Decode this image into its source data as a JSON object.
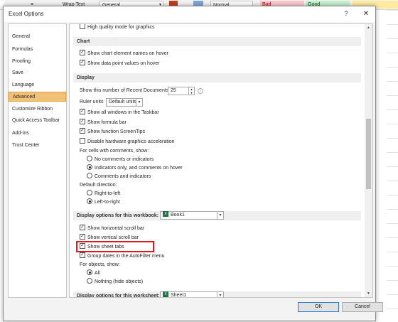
{
  "ribbon": {
    "font_fragment": "",
    "wrap_text": "Wrap Text",
    "number_format": "General",
    "styles": {
      "normal": "Normal",
      "bad": "Bad",
      "good": "Good"
    }
  },
  "dialog": {
    "title": "Excel Options",
    "help_glyph": "?",
    "close_glyph": "✕"
  },
  "nav": {
    "items": [
      {
        "label": "General",
        "selected": false
      },
      {
        "label": "Formulas",
        "selected": false
      },
      {
        "label": "Proofing",
        "selected": false
      },
      {
        "label": "Save",
        "selected": false
      },
      {
        "label": "Language",
        "selected": false
      },
      {
        "label": "Advanced",
        "selected": true
      },
      {
        "label": "Customize Ribbon",
        "selected": false
      },
      {
        "label": "Quick Access Toolbar",
        "selected": false
      },
      {
        "label": "Add-ins",
        "selected": false
      },
      {
        "label": "Trust Center",
        "selected": false
      }
    ]
  },
  "content": {
    "top_partial": {
      "label": "High quality mode for graphics",
      "checked": false
    },
    "chart": {
      "heading": "Chart",
      "opts": [
        {
          "label": "Show chart element names on hover",
          "checked": true
        },
        {
          "label": "Show data point values on hover",
          "checked": true
        }
      ]
    },
    "display": {
      "heading": "Display",
      "recent_docs_label": "Show this number of Recent Documents:",
      "recent_docs_value": "25",
      "ruler_label": "Ruler units",
      "ruler_value": "Default units",
      "opts": [
        {
          "label": "Show all windows in the Taskbar",
          "checked": true
        },
        {
          "label": "Show formula bar",
          "checked": true
        },
        {
          "label": "Show function ScreenTips",
          "checked": true
        },
        {
          "label": "Disable hardware graphics acceleration",
          "checked": false
        }
      ],
      "comments_label": "For cells with comments, show:",
      "comments_opts": [
        {
          "label": "No comments or indicators",
          "selected": false
        },
        {
          "label": "Indicators only, and comments on hover",
          "selected": true
        },
        {
          "label": "Comments and indicators",
          "selected": false
        }
      ],
      "direction_label": "Default direction:",
      "direction_opts": [
        {
          "label": "Right-to-left",
          "selected": false
        },
        {
          "label": "Left-to-right",
          "selected": true
        }
      ]
    },
    "workbook": {
      "heading": "Display options for this workbook:",
      "select_value": "Book1",
      "opts": [
        {
          "label": "Show horizontal scroll bar",
          "checked": true
        },
        {
          "label": "Show vertical scroll bar",
          "checked": true
        },
        {
          "label": "Show sheet tabs",
          "checked": true
        },
        {
          "label": "Group dates in the AutoFilter menu",
          "checked": true
        }
      ],
      "objects_label": "For objects, show:",
      "objects_opts": [
        {
          "label": "All",
          "selected": true
        },
        {
          "label": "Nothing (hide objects)",
          "selected": false
        }
      ]
    },
    "worksheet": {
      "heading": "Display options for this worksheet:",
      "select_value": "Sheet1"
    }
  },
  "buttons": {
    "ok": "OK",
    "cancel": "Cancel"
  },
  "glyphs": {
    "check": "✓",
    "dropdown": "▾",
    "up": "▲",
    "down": "▼",
    "info": "i",
    "xl": "X"
  },
  "colors": {
    "selected_nav": "#f0c277",
    "highlight_box": "#e11b1b",
    "excel_green": "#217346"
  }
}
